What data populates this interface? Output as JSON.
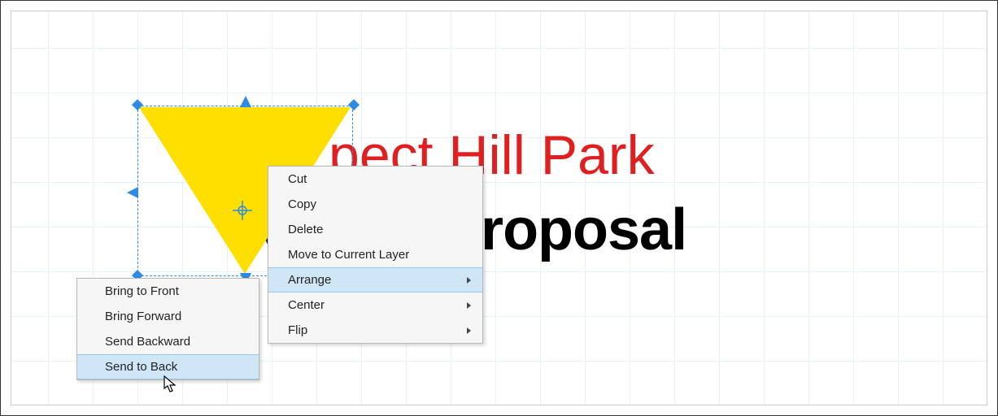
{
  "document": {
    "title_red": "pect Hill Park",
    "title_black_visible": "seating proposal"
  },
  "context_menu": {
    "items": [
      {
        "label": "Cut",
        "has_submenu": false
      },
      {
        "label": "Copy",
        "has_submenu": false
      },
      {
        "label": "Delete",
        "has_submenu": false
      },
      {
        "label": "Move to Current Layer",
        "has_submenu": false
      },
      {
        "label": "Arrange",
        "has_submenu": true,
        "highlighted": true
      },
      {
        "label": "Center",
        "has_submenu": true
      },
      {
        "label": "Flip",
        "has_submenu": true
      }
    ]
  },
  "arrange_submenu": {
    "items": [
      {
        "label": "Bring to Front"
      },
      {
        "label": "Bring Forward"
      },
      {
        "label": "Send Backward"
      },
      {
        "label": "Send to Back",
        "highlighted": true
      }
    ]
  },
  "colors": {
    "selection": "#2d8ae5",
    "shape_fill": "#ffdf00",
    "menu_highlight": "#cfe6f7"
  }
}
